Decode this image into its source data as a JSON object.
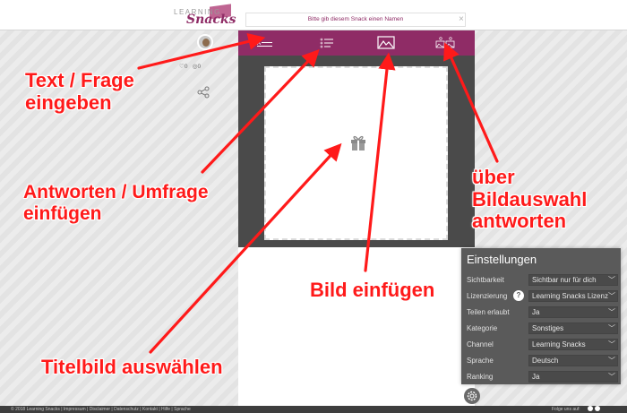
{
  "header": {
    "logo_small": "LEARNING",
    "logo_main": "Snacks",
    "name_placeholder": "Bitte gib diesem Snack einen Namen",
    "close": "×"
  },
  "stats": {
    "likes": "0",
    "views": "0"
  },
  "toolbar": {
    "icons": [
      "text-tool-icon",
      "answers-tool-icon",
      "image-tool-icon",
      "image-answer-tool-icon"
    ]
  },
  "annotations": {
    "text_frage": "Text / Frage\neingeben",
    "antworten": "Antworten / Umfrage\neinfügen",
    "titelbild": "Titelbild auswählen",
    "bild_einfuegen": "Bild einfügen",
    "bildauswahl": "über\nBildauswahl\nantworten"
  },
  "settings": {
    "title": "Einstellungen",
    "rows": [
      {
        "label": "Sichtbarkeit",
        "value": "Sichtbar nur für dich"
      },
      {
        "label": "Lizenzierung",
        "value": "Learning Snacks Lizenz"
      },
      {
        "label": "Teilen erlaubt",
        "value": "Ja"
      },
      {
        "label": "Kategorie",
        "value": "Sonstiges"
      },
      {
        "label": "Channel",
        "value": "Learning Snacks"
      },
      {
        "label": "Sprache",
        "value": "Deutsch"
      },
      {
        "label": "Ranking",
        "value": "Ja"
      }
    ],
    "help": "?"
  },
  "footer": {
    "left": "© 2018 Learning Snacks | Impressum | Disclaimer | Datenschutz | Kontakt | Hilfe | Sprache",
    "right": "Folge uns auf:"
  },
  "colors": {
    "accent": "#8f2c66",
    "annotation": "#ff1a1a",
    "stage": "#4a4a4a",
    "settings_bg": "#5a5a5a"
  }
}
